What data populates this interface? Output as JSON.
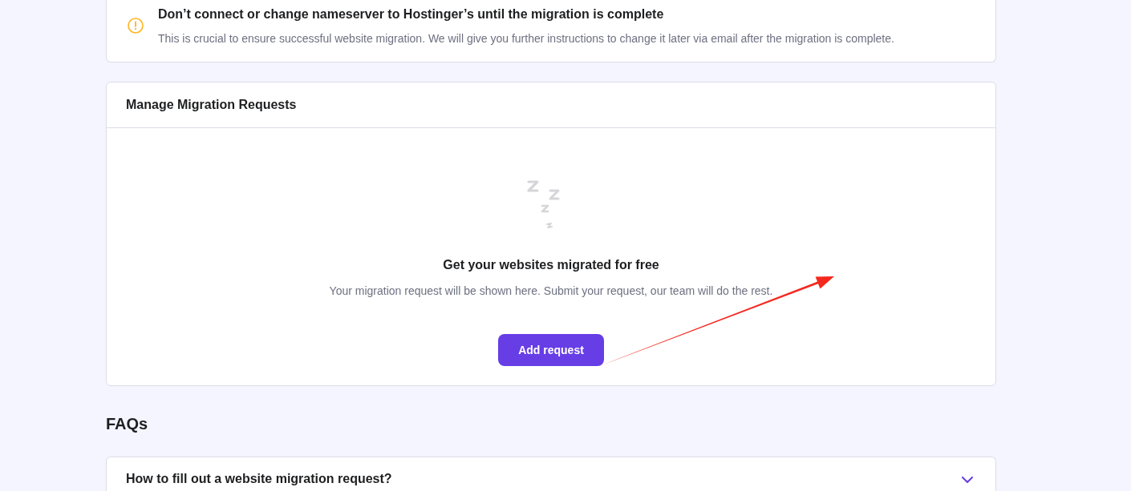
{
  "notice": {
    "kind": "warning",
    "title": "Don’t connect or change nameserver to Hostinger’s until the migration is complete",
    "text": "This is crucial to ensure successful website migration. We will give you further instructions to change it later via email after the migration is complete."
  },
  "migration_requests": {
    "title": "Manage Migration Requests",
    "empty_state": {
      "heading": "Get your websites migrated for free",
      "text": "Your migration request will be shown here. Submit your request, our team will do the rest.",
      "button": "Add request"
    }
  },
  "faq": {
    "title": "FAQs",
    "items": [
      {
        "question": "How to fill out a website migration request?",
        "expanded": false
      }
    ]
  },
  "annotations": [
    {
      "kind": "arrow"
    }
  ]
}
